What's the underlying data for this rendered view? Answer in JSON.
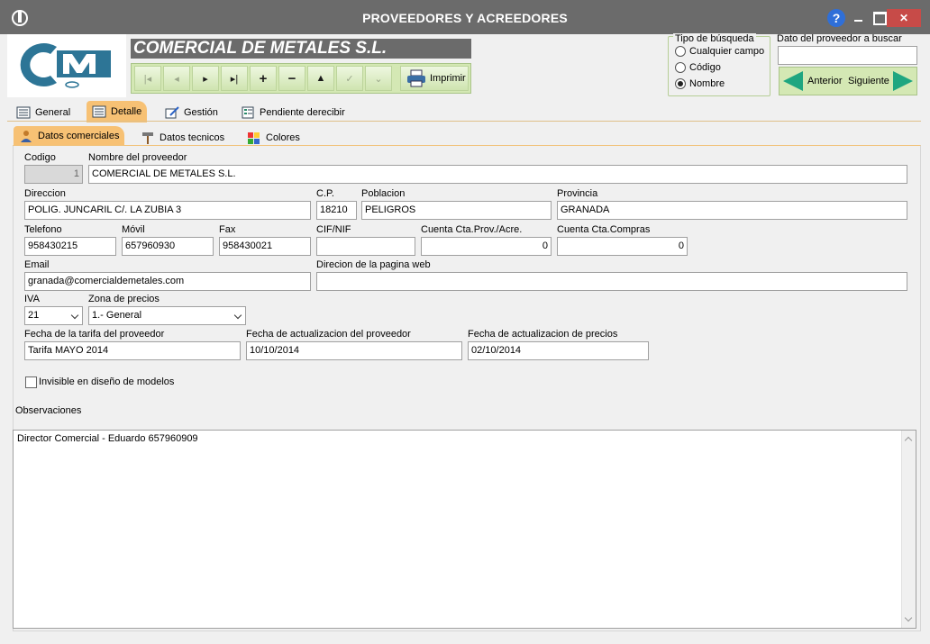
{
  "window": {
    "title": "PROVEEDORES Y ACREEDORES",
    "close": "✕",
    "help": "?"
  },
  "company_name": "COMERCIAL DE METALES S.L.",
  "toolbar": {
    "print_label": "Imprimir"
  },
  "search": {
    "group_label": "Tipo de búsqueda",
    "options": [
      "Cualquier campo",
      "Código",
      "Nombre"
    ],
    "selected": "Nombre",
    "field_label": "Dato del proveedor a buscar",
    "field_value": "",
    "prev_label": "Anterior",
    "next_label": "Siguiente"
  },
  "main_tabs": [
    "General",
    "Detalle",
    "Gestión",
    "Pendiente derecibir"
  ],
  "sub_tabs": [
    "Datos comerciales",
    "Datos tecnicos",
    "Colores"
  ],
  "form": {
    "codigo_label": "Codigo",
    "codigo": "1",
    "nombre_label": "Nombre del proveedor",
    "nombre": "COMERCIAL DE METALES S.L.",
    "direccion_label": "Direccion",
    "direccion": "POLIG. JUNCARIL C/. LA ZUBIA 3",
    "cp_label": "C.P.",
    "cp": "18210",
    "poblacion_label": "Poblacion",
    "poblacion": "PELIGROS",
    "provincia_label": "Provincia",
    "provincia": "GRANADA",
    "telefono_label": "Telefono",
    "telefono": "958430215",
    "movil_label": "Móvil",
    "movil": "657960930",
    "fax_label": "Fax",
    "fax": "958430021",
    "cif_label": "CIF/NIF",
    "cif": "",
    "cuenta_prov_label": "Cuenta Cta.Prov./Acre.",
    "cuenta_prov": "0",
    "cuenta_compras_label": "Cuenta Cta.Compras",
    "cuenta_compras": "0",
    "email_label": "Email",
    "email": "granada@comercialdemetales.com",
    "web_label": "Direcion de la pagina web",
    "web": "",
    "iva_label": "IVA",
    "iva": "21",
    "zona_label": "Zona de precios",
    "zona": "1.- General",
    "tarifa_label": "Fecha de la tarifa del proveedor",
    "tarifa": "Tarifa MAYO 2014",
    "act_prov_label": "Fecha de actualizacion del proveedor",
    "act_prov": "10/10/2014",
    "act_precios_label": "Fecha de actualizacion de precios",
    "act_precios": "02/10/2014",
    "invisible_label": "Invisible en diseño de modelos",
    "observaciones_label": "Observaciones",
    "observaciones": "Director Comercial - Eduardo 657960909"
  },
  "colors": {
    "titlebar": "#6b6b6b",
    "close": "#c74b48",
    "accent_tab": "#f7c174",
    "toolbar": "#d4e8b4",
    "arrow": "#1fa680"
  }
}
